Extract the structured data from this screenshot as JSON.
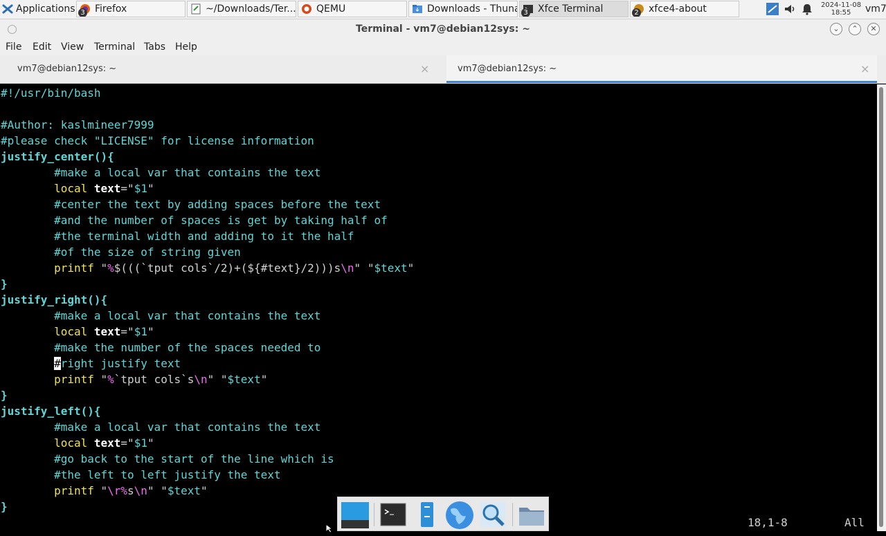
{
  "panel": {
    "applications_label": "Applications",
    "tasks": [
      {
        "label": "Firefox",
        "badge": "3",
        "icon": "firefox-icon"
      },
      {
        "label": "~/Downloads/Ter...",
        "icon": "text-editor-icon"
      },
      {
        "label": "QEMU",
        "icon": "qemu-icon"
      },
      {
        "label": "Downloads - Thunar",
        "icon": "thunar-icon"
      },
      {
        "label": "Xfce Terminal",
        "badge": "3",
        "icon": "terminal-icon"
      },
      {
        "label": "xfce4-about",
        "badge": "2",
        "icon": "about-icon"
      }
    ],
    "date": "2024-11-08",
    "time": "18:55",
    "user": "vm7"
  },
  "window": {
    "title": "Terminal - vm7@debian12sys: ~"
  },
  "menu": [
    "File",
    "Edit",
    "View",
    "Terminal",
    "Tabs",
    "Help"
  ],
  "tabs": [
    {
      "label": "vm7@debian12sys: ~",
      "active": false
    },
    {
      "label": "vm7@debian12sys: ~",
      "active": true
    }
  ],
  "editor": {
    "status_position": "18,1-8",
    "status_scroll": "All"
  },
  "code_lines": [
    "#!/usr/bin/bash",
    "",
    "#Author: kaslmineer7999",
    "#please check \"LICENSE\" for license information",
    "justify_center(){",
    "        #make a local var that contains the text",
    "        local text=\"$1\"",
    "        #center the text by adding spaces before the text",
    "        #and the number of spaces is get by taking half of",
    "        #the terminal width and adding to it the half",
    "        #of the size of string given",
    "        printf \"%$(((`tput cols`/2)+(${#text}/2)))s\\n\" \"$text\"",
    "}",
    "justify_right(){",
    "        #make a local var that contains the text",
    "        local text=\"$1\"",
    "        #make the number of the spaces needed to",
    "        #right justify text",
    "        printf \"%`tput cols`s\\n\" \"$text\"",
    "}",
    "justify_left(){",
    "        #make a local var that contains the text",
    "        local text=\"$1\"",
    "        #go back to the start of the line which is",
    "        #the left to left justify the text",
    "        printf \"\\r%s\\n\" \"$text\"",
    "}"
  ],
  "dock": [
    {
      "icon": "show-desktop-icon"
    },
    {
      "icon": "terminal-icon"
    },
    {
      "icon": "file-manager-icon"
    },
    {
      "icon": "web-browser-icon"
    },
    {
      "icon": "app-finder-icon"
    },
    {
      "icon": "folder-icon"
    }
  ],
  "colors": {
    "comment": "#5fd7d7",
    "keyword": "#f0e35a",
    "special": "#ee6bee",
    "tab_accent": "#3d86d6"
  }
}
